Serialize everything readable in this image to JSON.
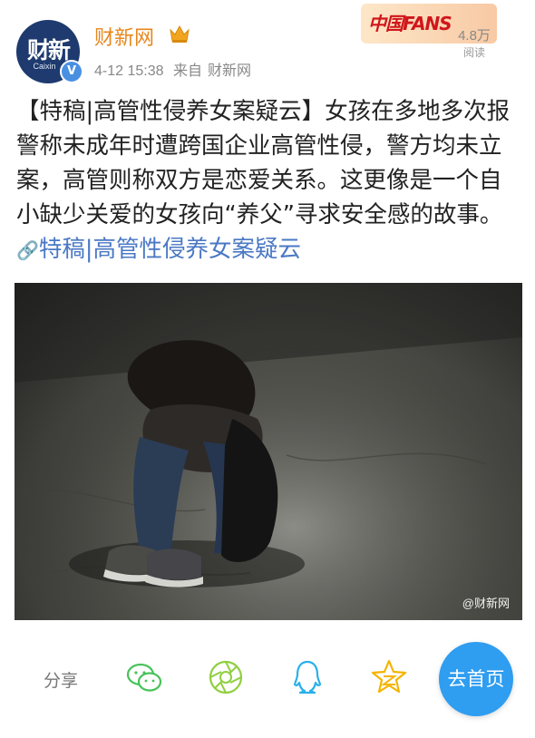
{
  "header": {
    "avatar": {
      "logo_cn": "财新",
      "logo_en": "Caixin",
      "verified_mark": "V"
    },
    "account_name": "财新网",
    "date": "4-12 15:38",
    "source_prefix": "来自",
    "source": "财新网",
    "fans_badge": "中国FANS",
    "views_count": "4.8万",
    "views_label": "阅读"
  },
  "post": {
    "text": "【特稿|高管性侵养女案疑云】女孩在多地多次报警称未成年时遭跨国企业高管性侵，警方均未立案，高管则称双方是恋爱关系。这更像是一个自小缺少关爱的女孩向“养父”寻求安全感的故事。",
    "link_icon": "🔗",
    "link_text": "特稿|高管性侵养女案疑云",
    "image_watermark": "@财新网"
  },
  "actions": {
    "share_label": "分享",
    "icons": [
      "wechat-icon",
      "moments-icon",
      "qq-icon",
      "qzone-icon"
    ],
    "home_button": "去首页"
  },
  "colors": {
    "account_name": "#e8861c",
    "link": "#4a78c4",
    "home_button": "#2f9df0",
    "avatar_bg": "#1e3a6e"
  }
}
